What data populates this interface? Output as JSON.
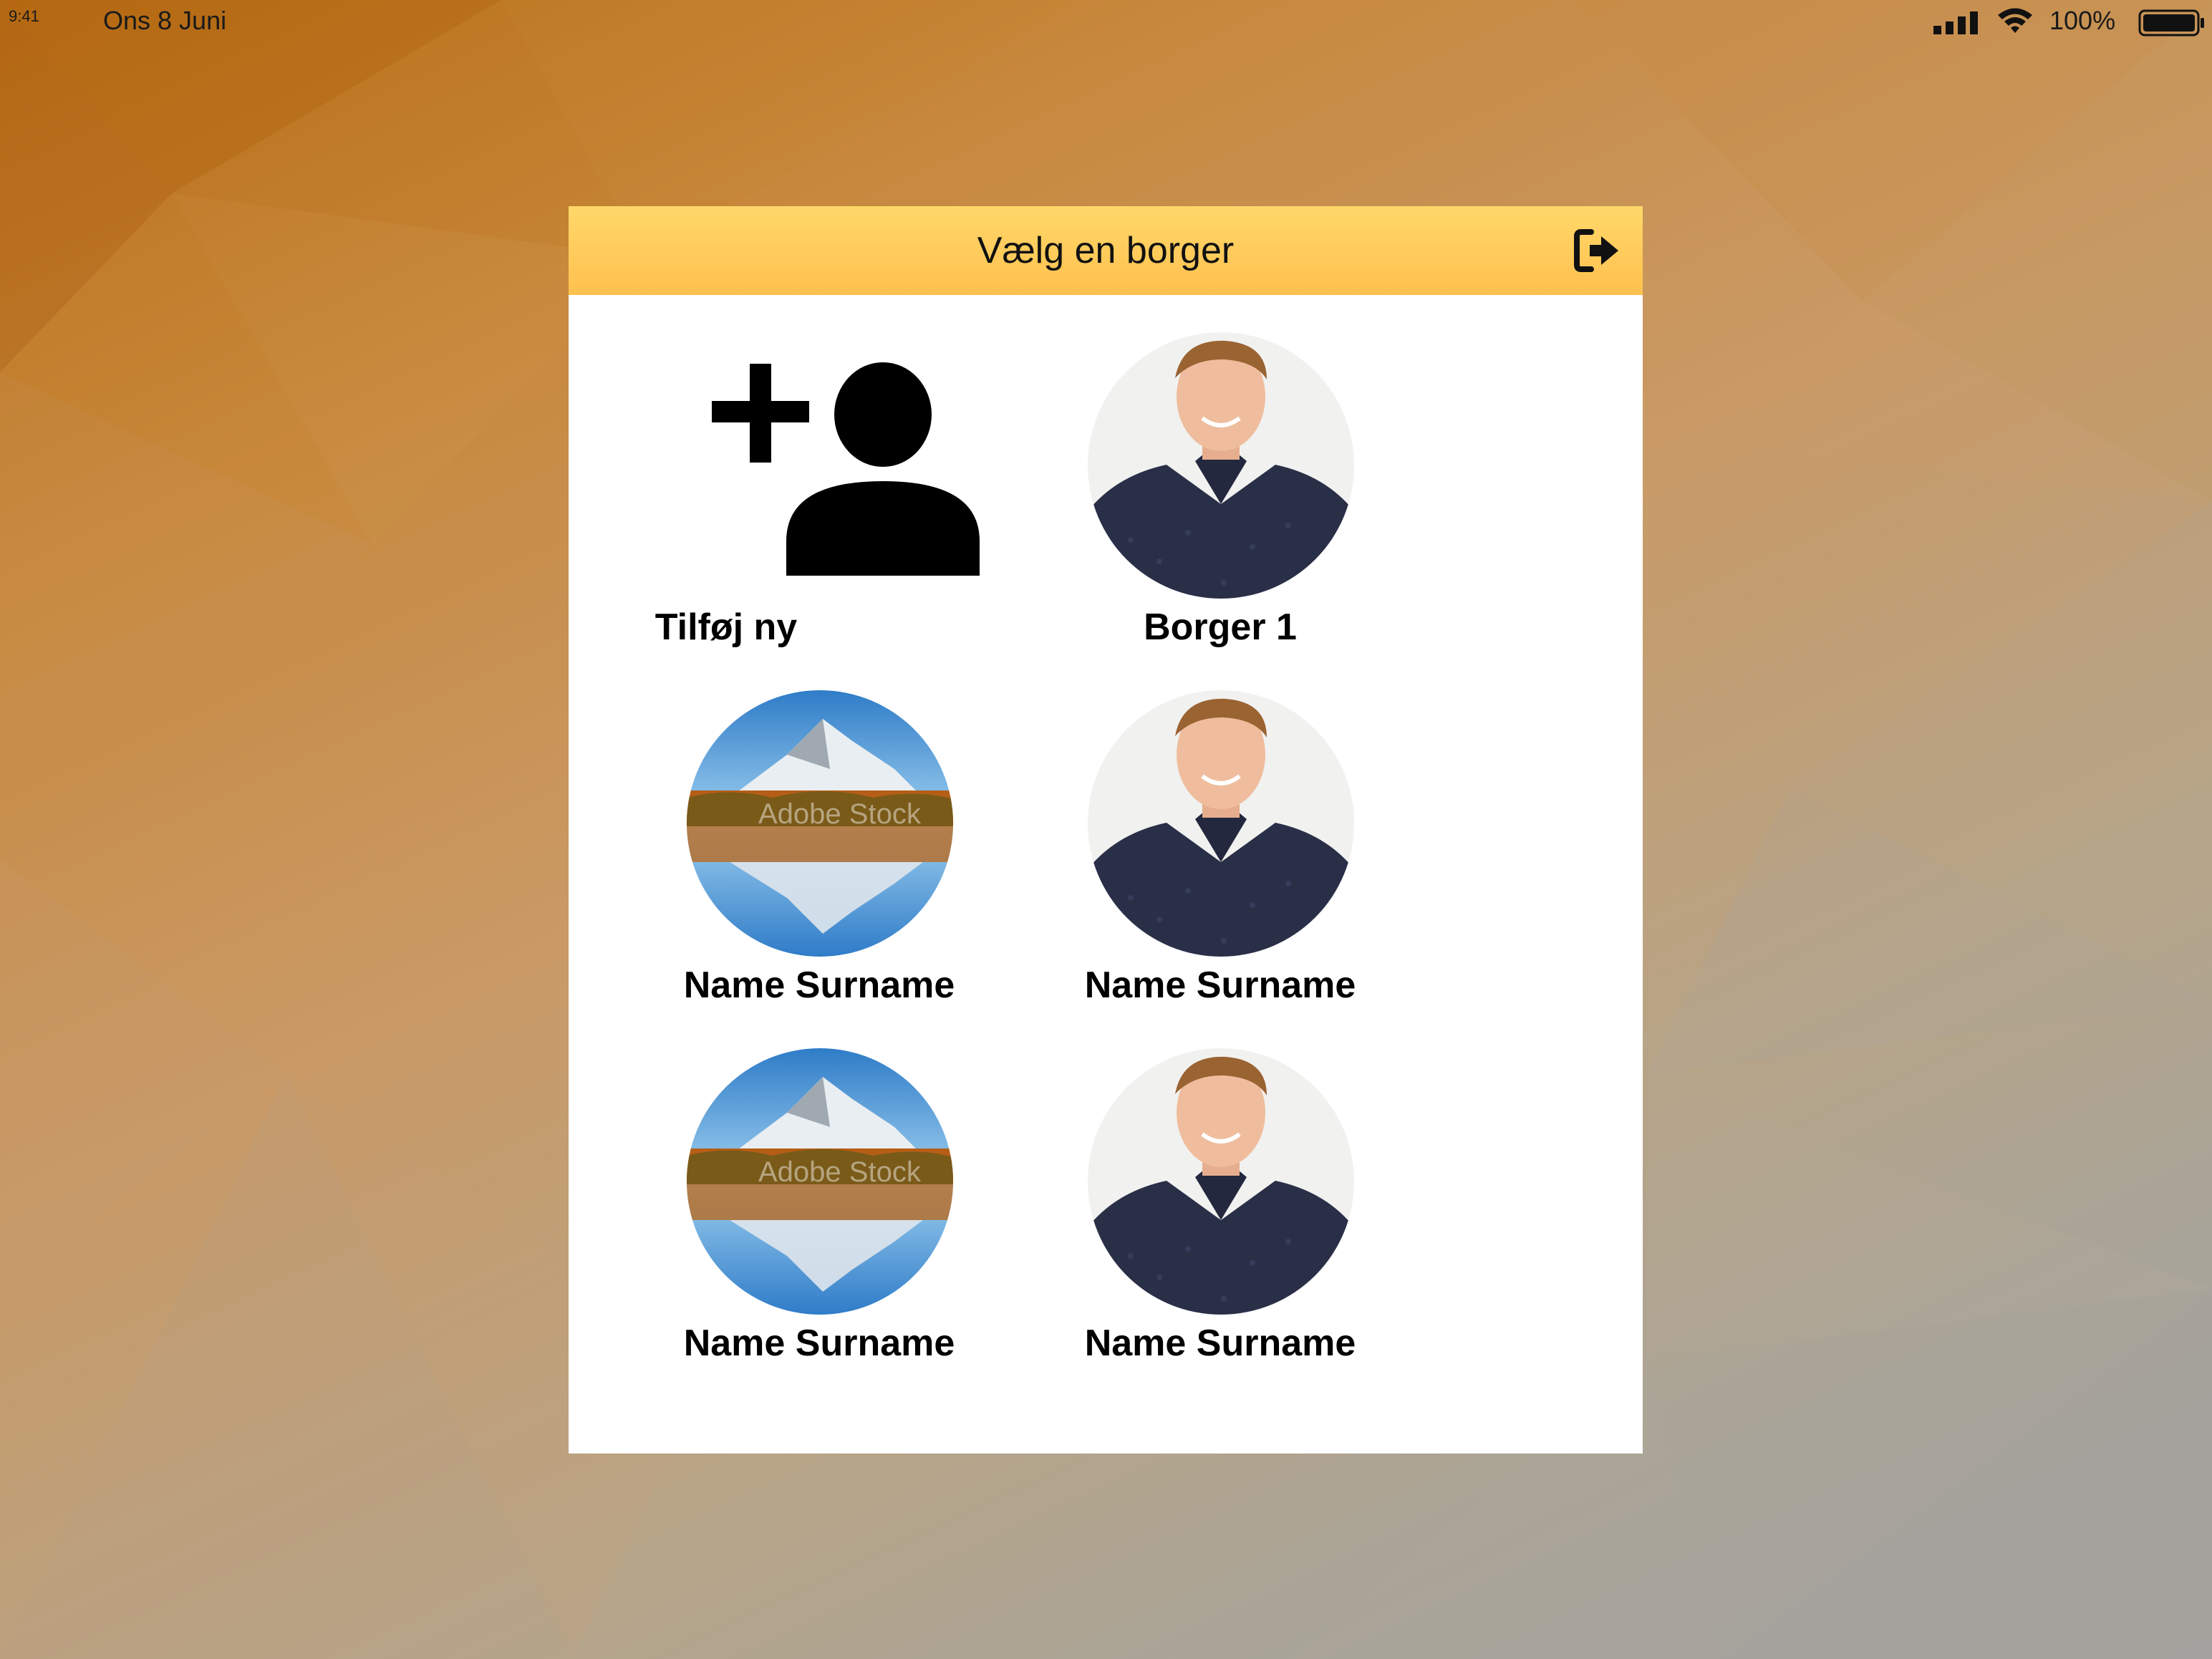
{
  "status_bar": {
    "time": "9:41",
    "date": "Ons 8 Juni",
    "battery_percent": "100%",
    "icons": [
      "cellular-signal-icon",
      "wifi-icon",
      "battery-icon"
    ]
  },
  "dialog": {
    "title": "Vælg en borger",
    "logout_icon": "logout-icon",
    "add_new": {
      "label": "Tilføj ny",
      "icon": "add-user-icon"
    },
    "citizens": [
      {
        "label": "Borger 1",
        "image": "portrait-photo"
      },
      {
        "label": "Name Surname",
        "image": "mountain-lake-photo"
      },
      {
        "label": "Name Surname",
        "image": "portrait-photo"
      },
      {
        "label": "Name Surname",
        "image": "mountain-lake-photo"
      },
      {
        "label": "Name Surname",
        "image": "portrait-photo"
      }
    ]
  },
  "watermark_text": "Adobe Stock",
  "colors": {
    "header_gradient_top": "#ffd86a",
    "header_gradient_bottom": "#ffc04e",
    "dialog_background": "#ffffff",
    "background_orange": "#b86c14",
    "background_grey": "#a6a39f"
  }
}
